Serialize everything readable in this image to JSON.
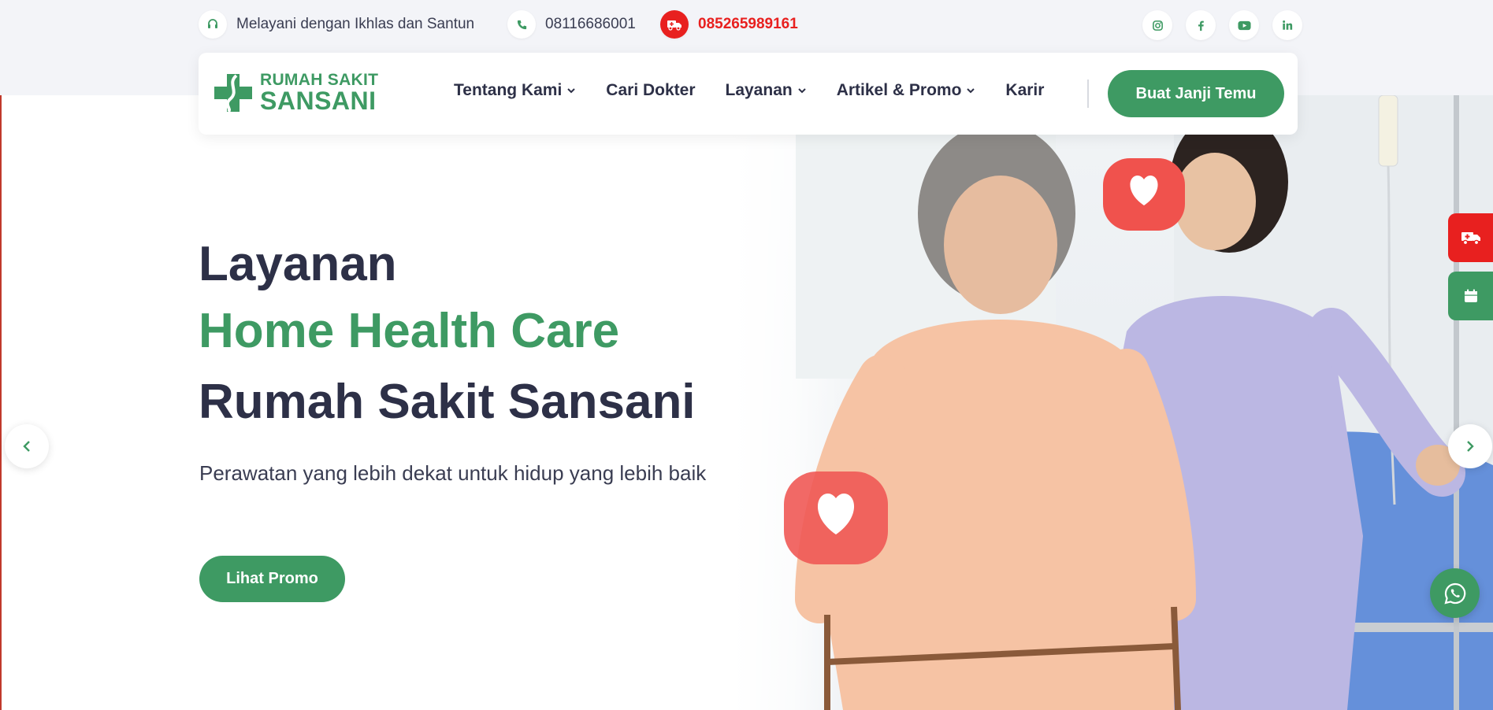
{
  "topbar": {
    "tagline": "Melayani dengan Ikhlas dan Santun",
    "phone": "08116686001",
    "emergency_phone": "085265989161",
    "social": [
      "instagram-icon",
      "facebook-icon",
      "youtube-icon",
      "linkedin-icon"
    ]
  },
  "brand": {
    "line1": "RUMAH SAKIT",
    "line2": "SANSANI",
    "color": "#3e9a63"
  },
  "nav": {
    "items": [
      {
        "label": "Tentang Kami",
        "dropdown": true
      },
      {
        "label": "Cari Dokter",
        "dropdown": false
      },
      {
        "label": "Layanan",
        "dropdown": true
      },
      {
        "label": "Artikel & Promo",
        "dropdown": true
      },
      {
        "label": "Karir",
        "dropdown": false
      }
    ],
    "cta_label": "Buat Janji Temu"
  },
  "hero": {
    "line1": "Layanan",
    "line2": "Home Health Care",
    "line3": "Rumah Sakit Sansani",
    "subtitle": "Perawatan yang lebih dekat untuk hidup yang lebih baik",
    "button_label": "Lihat Promo"
  },
  "colors": {
    "accent": "#3e9a63",
    "emergency": "#e8201f",
    "dark_text": "#2d3047"
  },
  "floating": {
    "ambulance": "ambulance-icon",
    "calendar": "calendar-icon",
    "whatsapp": "whatsapp-icon"
  }
}
